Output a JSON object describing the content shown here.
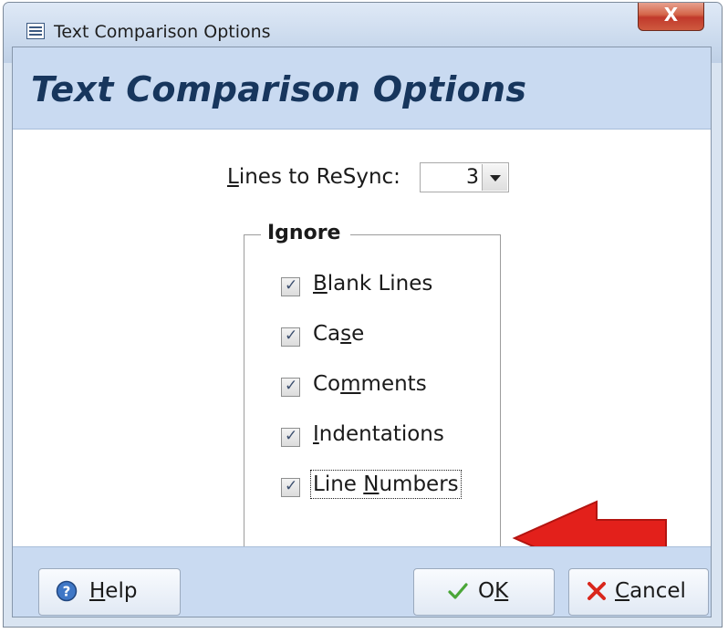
{
  "window": {
    "title": "Text Comparison Options",
    "close_glyph": "X"
  },
  "header": {
    "title": "Text Comparison Options"
  },
  "resync": {
    "label_prefix": "L",
    "label_rest": "ines to ReSync:",
    "value": "3"
  },
  "ignore_group": {
    "label": "Ignore",
    "options": [
      {
        "pre": "",
        "accel": "B",
        "post": "lank Lines",
        "checked": true
      },
      {
        "pre": "Ca",
        "accel": "s",
        "post": "e",
        "checked": true
      },
      {
        "pre": "Co",
        "accel": "m",
        "post": "ments",
        "checked": true
      },
      {
        "pre": "",
        "accel": "I",
        "post": "ndentations",
        "checked": true
      },
      {
        "pre": "Line ",
        "accel": "N",
        "post": "umbers",
        "checked": true
      }
    ]
  },
  "buttons": {
    "help": {
      "accel": "H",
      "rest": "elp"
    },
    "ok": {
      "pre": "O",
      "accel": "K"
    },
    "cancel": {
      "accel": "C",
      "rest": "ancel"
    }
  },
  "colors": {
    "arrow": "#e3201b",
    "header_bg": "#c9daf1",
    "header_text": "#17365d"
  }
}
